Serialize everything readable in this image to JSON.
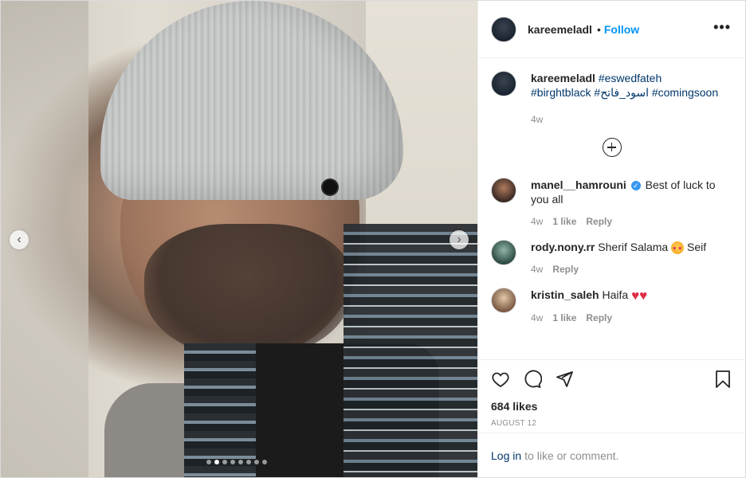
{
  "author": {
    "username": "kareemeladl",
    "separator": "•",
    "follow_label": "Follow",
    "more_label": "•••"
  },
  "media": {
    "dot_count": 8,
    "active_dot": 1,
    "prev_icon": "chevron-left-icon",
    "next_icon": "chevron-right-icon"
  },
  "caption": {
    "username": "kareemeladl",
    "tags_line1": "#eswedfateh",
    "tags_line2_a": "#birghtblack",
    "tags_line2_b": "#اسود_فاتح",
    "tags_line2_c": "#comingsoon",
    "time": "4w"
  },
  "comments": [
    {
      "username": "manel__hamrouni",
      "verified": true,
      "text": "Best of luck to you all",
      "time": "4w",
      "likes": "1 like",
      "reply": "Reply"
    },
    {
      "username": "rody.nony.rr",
      "text_before": "Sherif Salama",
      "text_after": "Seif",
      "time": "4w",
      "reply": "Reply"
    },
    {
      "username": "kristin_saleh",
      "text": "Haifa",
      "time": "4w",
      "likes": "1 like",
      "reply": "Reply"
    }
  ],
  "stats": {
    "likes": "684 likes",
    "date": "AUGUST 12"
  },
  "login": {
    "link": "Log in",
    "text": "to like or comment."
  },
  "colors": {
    "link_blue": "#0095f6",
    "hashtag": "#00376b",
    "muted": "#8e8e8e",
    "verified": "#3897f0"
  }
}
